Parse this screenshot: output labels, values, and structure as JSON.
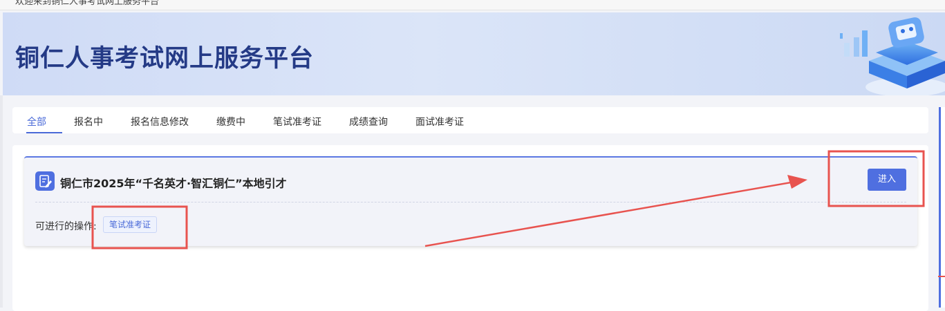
{
  "topbar": {
    "welcome_text": "欢迎来到铜仁人事考试网上服务平台"
  },
  "banner": {
    "title": "铜仁人事考试网上服务平台"
  },
  "tabs": [
    {
      "label": "全部",
      "active": true
    },
    {
      "label": "报名中",
      "active": false
    },
    {
      "label": "报名信息修改",
      "active": false
    },
    {
      "label": "缴费中",
      "active": false
    },
    {
      "label": "笔试准考证",
      "active": false
    },
    {
      "label": "成绩查询",
      "active": false
    },
    {
      "label": "面试准考证",
      "active": false
    }
  ],
  "exam": {
    "title": "铜仁市2025年“千名英才·智汇铜仁”本地引才",
    "operations_label": "可进行的操作:",
    "operation_tag": "笔试准考证",
    "enter_button": "进入"
  },
  "colors": {
    "accent": "#4f6fe0",
    "banner_title": "#243a86",
    "annotation": "#e8534f"
  }
}
